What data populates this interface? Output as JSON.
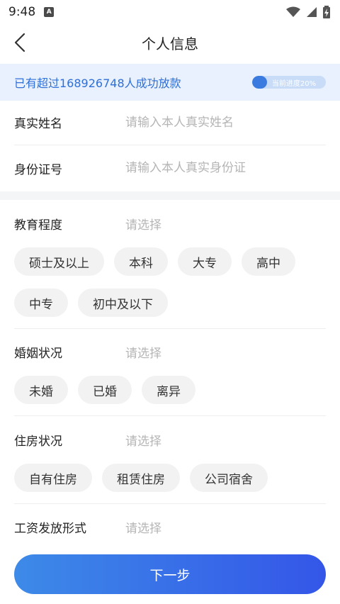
{
  "status": {
    "time": "9:48",
    "app_icon_letter": "A",
    "icons": [
      "wifi-icon",
      "signal-icon",
      "battery-charging-icon"
    ]
  },
  "header": {
    "title": "个人信息",
    "back_icon": "chevron-left-icon"
  },
  "banner": {
    "text": "已有超过168926748人成功放款",
    "progress_label": "当前进度20%",
    "progress_percent": 20,
    "accent_color": "#2f6fd6"
  },
  "identity": {
    "name": {
      "label": "真实姓名",
      "value": "",
      "placeholder": "请输入本人真实姓名"
    },
    "id_number": {
      "label": "身份证号",
      "value": "",
      "placeholder": "请输入本人真实身份证"
    }
  },
  "education": {
    "label": "教育程度",
    "value": "请选择",
    "options": [
      "硕士及以上",
      "本科",
      "大专",
      "高中",
      "中专",
      "初中及以下"
    ]
  },
  "marriage": {
    "label": "婚姻状况",
    "value": "请选择",
    "options": [
      "未婚",
      "已婚",
      "离异"
    ]
  },
  "housing": {
    "label": "住房状况",
    "value": "请选择",
    "options": [
      "自有住房",
      "租赁住房",
      "公司宿舍"
    ]
  },
  "salary": {
    "label": "工资发放形式",
    "value": "请选择"
  },
  "footer": {
    "next_label": "下一步",
    "button_gradient": [
      "#3d8ae8",
      "#3456e8"
    ]
  }
}
